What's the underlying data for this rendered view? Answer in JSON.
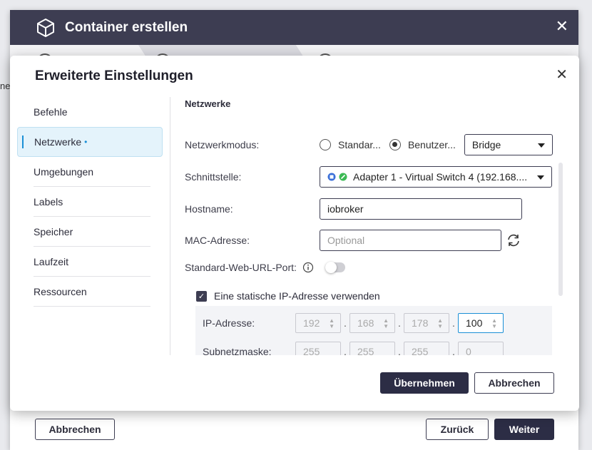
{
  "wizard": {
    "title": "Container erstellen",
    "left_peek": "ne",
    "footer": {
      "cancel": "Abbrechen",
      "back": "Zurück",
      "next": "Weiter"
    }
  },
  "dialog": {
    "title": "Erweiterte Einstellungen",
    "sidebar": {
      "items": [
        {
          "label": "Befehle"
        },
        {
          "label": "Netzwerke",
          "dot": "•"
        },
        {
          "label": "Umgebungen"
        },
        {
          "label": "Labels"
        },
        {
          "label": "Speicher"
        },
        {
          "label": "Laufzeit"
        },
        {
          "label": "Ressourcen"
        }
      ]
    },
    "section_title": "Netzwerke",
    "network_mode": {
      "label": "Netzwerkmodus:",
      "option_standard": "Standar...",
      "option_custom": "Benutzer...",
      "selected": "Benutzer...",
      "select_value": "Bridge"
    },
    "interface": {
      "label": "Schnittstelle:",
      "value": "Adapter 1 - Virtual Switch 4 (192.168...."
    },
    "hostname": {
      "label": "Hostname:",
      "value": "iobroker"
    },
    "mac": {
      "label": "MAC-Adresse:",
      "placeholder": "Optional"
    },
    "web_url_port": {
      "label": "Standard-Web-URL-Port:",
      "enabled": false
    },
    "static_ip": {
      "label": "Eine statische IP-Adresse verwenden",
      "checked": true,
      "ip_label": "IP-Adresse:",
      "ip": [
        "192",
        "168",
        "178",
        "100"
      ],
      "subnet_label": "Subnetzmaske:",
      "subnet": [
        "255",
        "255",
        "255",
        "0"
      ]
    },
    "footer": {
      "apply": "Übernehmen",
      "cancel": "Abbrechen"
    }
  }
}
